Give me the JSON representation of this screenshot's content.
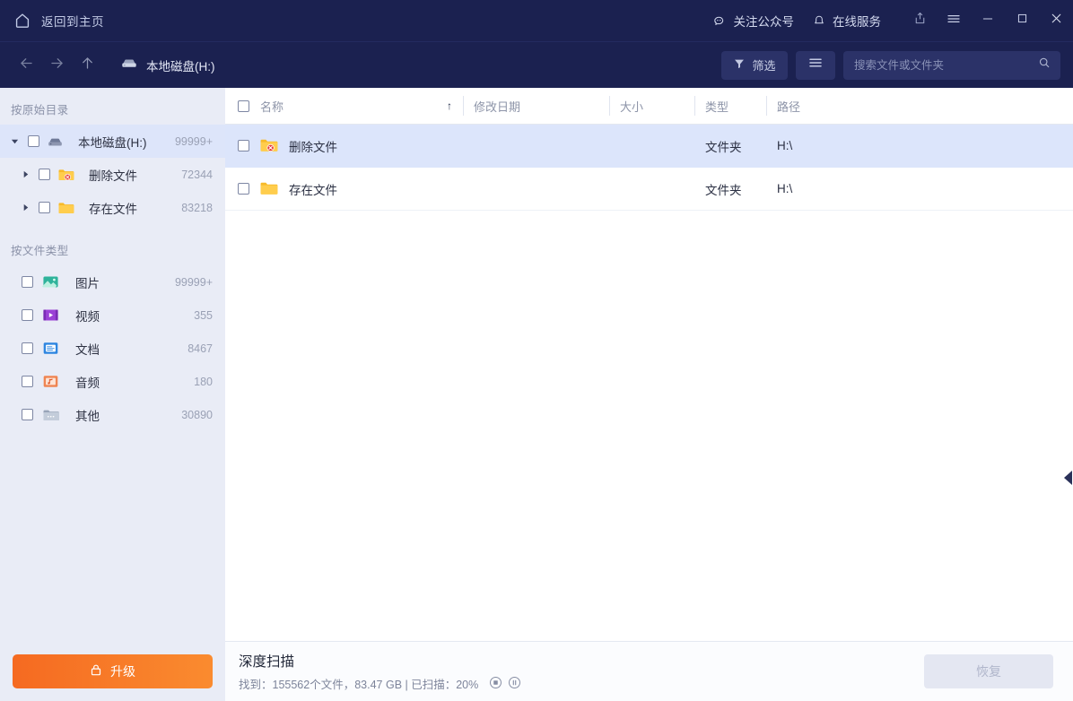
{
  "titlebar": {
    "home_label": "返回到主页",
    "home_icon": "home-icon",
    "follow_label": "关注公众号",
    "follow_icon": "chat-bubble-icon",
    "service_label": "在线服务",
    "service_icon": "bell-icon",
    "share_icon": "share-icon",
    "menu_icon": "hamburger-menu-icon",
    "minimize_icon": "minimize-icon",
    "maximize_icon": "maximize-icon",
    "close_icon": "close-icon"
  },
  "navbar": {
    "back_icon": "arrow-left-icon",
    "forward_icon": "arrow-right-icon",
    "up_icon": "arrow-up-icon",
    "breadcrumb_icon": "hard-drive-icon",
    "breadcrumb_label": "本地磁盘(H:)",
    "filter_label": "筛选",
    "filter_icon": "funnel-icon",
    "view_icon": "list-view-icon",
    "search_placeholder": "搜索文件或文件夹",
    "search_value": "",
    "search_icon": "search-icon"
  },
  "sidebar": {
    "section_tree_title": "按原始目录",
    "tree": [
      {
        "label": "本地磁盘(H:)",
        "count": "99999+",
        "icon": "hard-drive-icon",
        "level": 0,
        "expanded": true,
        "selected": true
      },
      {
        "label": "删除文件",
        "count": "72344",
        "icon": "folder-deleted-icon",
        "level": 1,
        "expanded": false,
        "selected": false
      },
      {
        "label": "存在文件",
        "count": "83218",
        "icon": "folder-icon",
        "level": 1,
        "expanded": false,
        "selected": false
      }
    ],
    "section_type_title": "按文件类型",
    "types": [
      {
        "label": "图片",
        "count": "99999+",
        "icon": "image-file-icon"
      },
      {
        "label": "视频",
        "count": "355",
        "icon": "video-file-icon"
      },
      {
        "label": "文档",
        "count": "8467",
        "icon": "document-file-icon"
      },
      {
        "label": "音频",
        "count": "180",
        "icon": "audio-file-icon"
      },
      {
        "label": "其他",
        "count": "30890",
        "icon": "other-file-icon"
      }
    ],
    "upgrade_label": "升级",
    "upgrade_icon": "lock-icon"
  },
  "table": {
    "columns": {
      "name": "名称",
      "date": "修改日期",
      "size": "大小",
      "type": "类型",
      "path": "路径"
    },
    "sort_indicator": "↑",
    "rows": [
      {
        "name": "删除文件",
        "date": "",
        "size": "",
        "type": "文件夹",
        "path": "H:\\",
        "icon": "folder-deleted-icon",
        "selected": true
      },
      {
        "name": "存在文件",
        "date": "",
        "size": "",
        "type": "文件夹",
        "path": "H:\\",
        "icon": "folder-icon",
        "selected": false
      }
    ]
  },
  "statusbar": {
    "scan_title": "深度扫描",
    "scan_summary": "找到：155562个文件，83.47 GB | 已扫描：20%",
    "stop_icon": "stop-icon",
    "pause_icon": "pause-icon",
    "restore_label": "恢复"
  },
  "panel_handle_icon": "collapse-left-icon",
  "colors": {
    "header_bg": "#1b2150",
    "sidebar_bg": "#e9ecf6",
    "row_selected": "#dce5fb",
    "accent_orange": "#f56a21",
    "folder_yellow": "#fbbc2e"
  }
}
